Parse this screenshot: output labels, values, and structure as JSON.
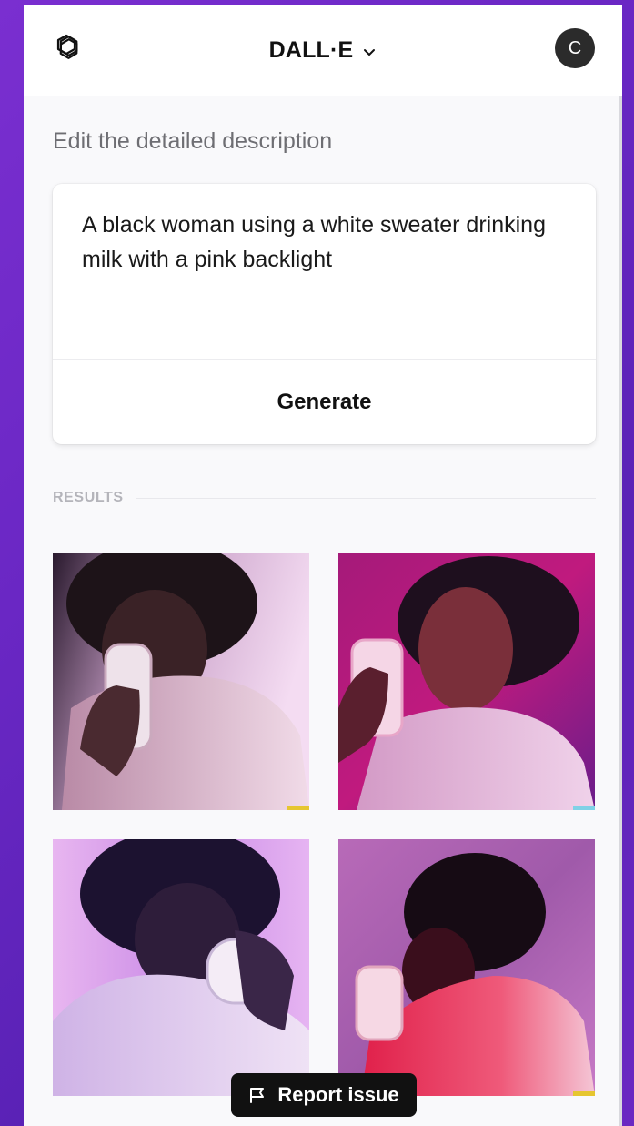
{
  "header": {
    "app_title": "DALL·E",
    "avatar_initial": "C",
    "logo_icon": "openai-logo-icon",
    "menu_icon": "chevron-down-icon"
  },
  "editor": {
    "section_label": "Edit the detailed description",
    "prompt": "A black woman using a white sweater drinking milk with a pink backlight",
    "generate_label": "Generate"
  },
  "results": {
    "label": "RESULTS",
    "images": [
      {
        "theme": "pink-white-backlight"
      },
      {
        "theme": "magenta-purple-backlight"
      },
      {
        "theme": "violet-backlight"
      },
      {
        "theme": "red-pink-backlight"
      }
    ]
  },
  "report": {
    "label": "Report issue",
    "icon": "flag-icon"
  },
  "colors": {
    "background_gradient_start": "#7a2fd0",
    "background_gradient_end": "#5a22b6",
    "accent_dark": "#111111",
    "muted_text": "#6e6e73"
  }
}
